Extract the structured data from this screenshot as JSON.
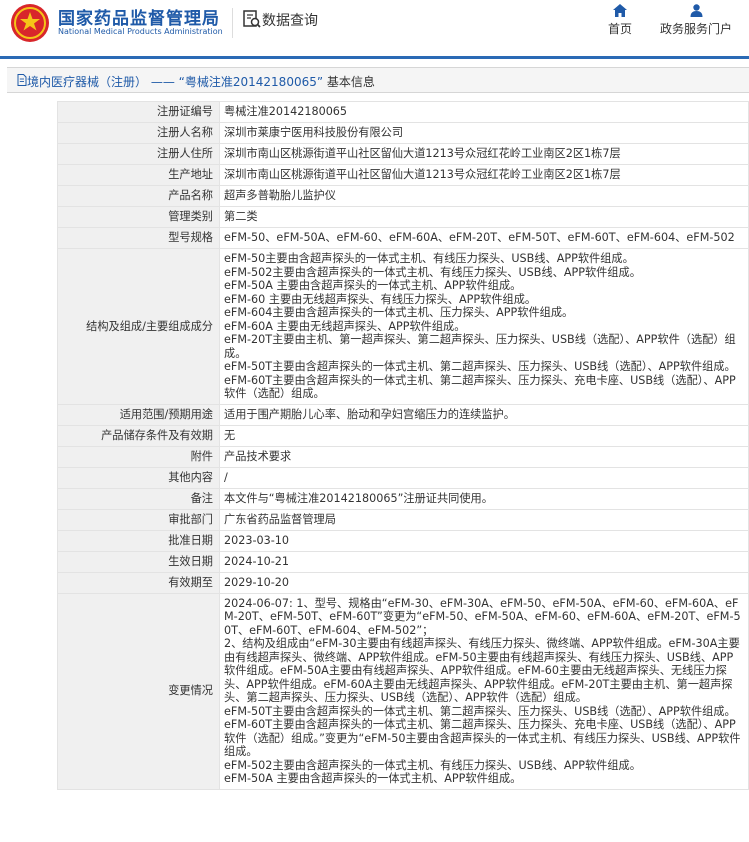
{
  "header": {
    "site_title": "国家药品监督管理局",
    "site_title_en": "National Medical Products Administration",
    "data_query_label": "数据查询",
    "nav": [
      {
        "label": "首页",
        "icon": "home-icon"
      },
      {
        "label": "政务服务门户",
        "icon": "user-icon"
      }
    ]
  },
  "breadcrumb": {
    "part1": "境内医疗器械（注册）",
    "sep": " —— ",
    "part2": "“粤械注准20142180065”",
    "part3": "基本信息"
  },
  "rows": [
    {
      "label": "注册证编号",
      "value": "粤械注准20142180065"
    },
    {
      "label": "注册人名称",
      "value": "深圳市莱康宁医用科技股份有限公司"
    },
    {
      "label": "注册人住所",
      "value": "深圳市南山区桃源街道平山社区留仙大道1213号众冠红花岭工业南区2区1栋7层"
    },
    {
      "label": "生产地址",
      "value": "深圳市南山区桃源街道平山社区留仙大道1213号众冠红花岭工业南区2区1栋7层"
    },
    {
      "label": "产品名称",
      "value": "超声多普勒胎儿监护仪"
    },
    {
      "label": "管理类别",
      "value": "第二类"
    },
    {
      "label": "型号规格",
      "value": "eFM-50、eFM-50A、eFM-60、eFM-60A、eFM-20T、eFM-50T、eFM-60T、eFM-604、eFM-502"
    },
    {
      "label": "结构及组成/主要组成成分",
      "value": "eFM-50主要由含超声探头的一体式主机、有线压力探头、USB线、APP软件组成。\neFM-502主要由含超声探头的一体式主机、有线压力探头、USB线、APP软件组成。\neFM-50A 主要由含超声探头的一体式主机、APP软件组成。\neFM-60 主要由无线超声探头、有线压力探头、APP软件组成。\neFM-604主要由含超声探头的一体式主机、压力探头、APP软件组成。\neFM-60A 主要由无线超声探头、APP软件组成。\neFM-20T主要由主机、第一超声探头、第二超声探头、压力探头、USB线（选配）、APP软件（选配）组成。\neFM-50T主要由含超声探头的一体式主机、第二超声探头、压力探头、USB线（选配）、APP软件组成。\neFM-60T主要由含超声探头的一体式主机、第二超声探头、压力探头、充电卡座、USB线（选配）、APP软件（选配）组成。"
    },
    {
      "label": "适用范围/预期用途",
      "value": "适用于围产期胎儿心率、胎动和孕妇宫缩压力的连续监护。"
    },
    {
      "label": "产品储存条件及有效期",
      "value": "无"
    },
    {
      "label": "附件",
      "value": "产品技术要求"
    },
    {
      "label": "其他内容",
      "value": "/"
    },
    {
      "label": "备注",
      "value": "本文件与“粤械注准20142180065”注册证共同使用。"
    },
    {
      "label": "审批部门",
      "value": "广东省药品监督管理局"
    },
    {
      "label": "批准日期",
      "value": "2023-03-10"
    },
    {
      "label": "生效日期",
      "value": "2024-10-21"
    },
    {
      "label": "有效期至",
      "value": "2029-10-20"
    },
    {
      "label": "变更情况",
      "value": "2024-06-07: 1、型号、规格由“eFM-30、eFM-30A、eFM-50、eFM-50A、eFM-60、eFM-60A、eFM-20T、eFM-50T、eFM-60T”变更为“eFM-50、eFM-50A、eFM-60、eFM-60A、eFM-20T、eFM-50T、eFM-60T、eFM-604、eFM-502”；\n2、结构及组成由“eFM-30主要由有线超声探头、有线压力探头、微终端、APP软件组成。eFM-30A主要由有线超声探头、微终端、APP软件组成。eFM-50主要由有线超声探头、有线压力探头、USB线、APP软件组成。eFM-50A主要由有线超声探头、APP软件组成。eFM-60主要由无线超声探头、无线压力探头、APP软件组成。eFM-60A主要由无线超声探头、APP软件组成。eFM-20T主要由主机、第一超声探头、第二超声探头、压力探头、USB线（选配）、APP软件（选配）组成。\neFM-50T主要由含超声探头的一体式主机、第二超声探头、压力探头、USB线（选配）、APP软件组成。\neFM-60T主要由含超声探头的一体式主机、第二超声探头、压力探头、充电卡座、USB线（选配）、APP软件（选配）组成。”变更为“eFM-50主要由含超声探头的一体式主机、有线压力探头、USB线、APP软件组成。\neFM-502主要由含超声探头的一体式主机、有线压力探头、USB线、APP软件组成。\neFM-50A 主要由含超声探头的一体式主机、APP软件组成。"
    }
  ]
}
